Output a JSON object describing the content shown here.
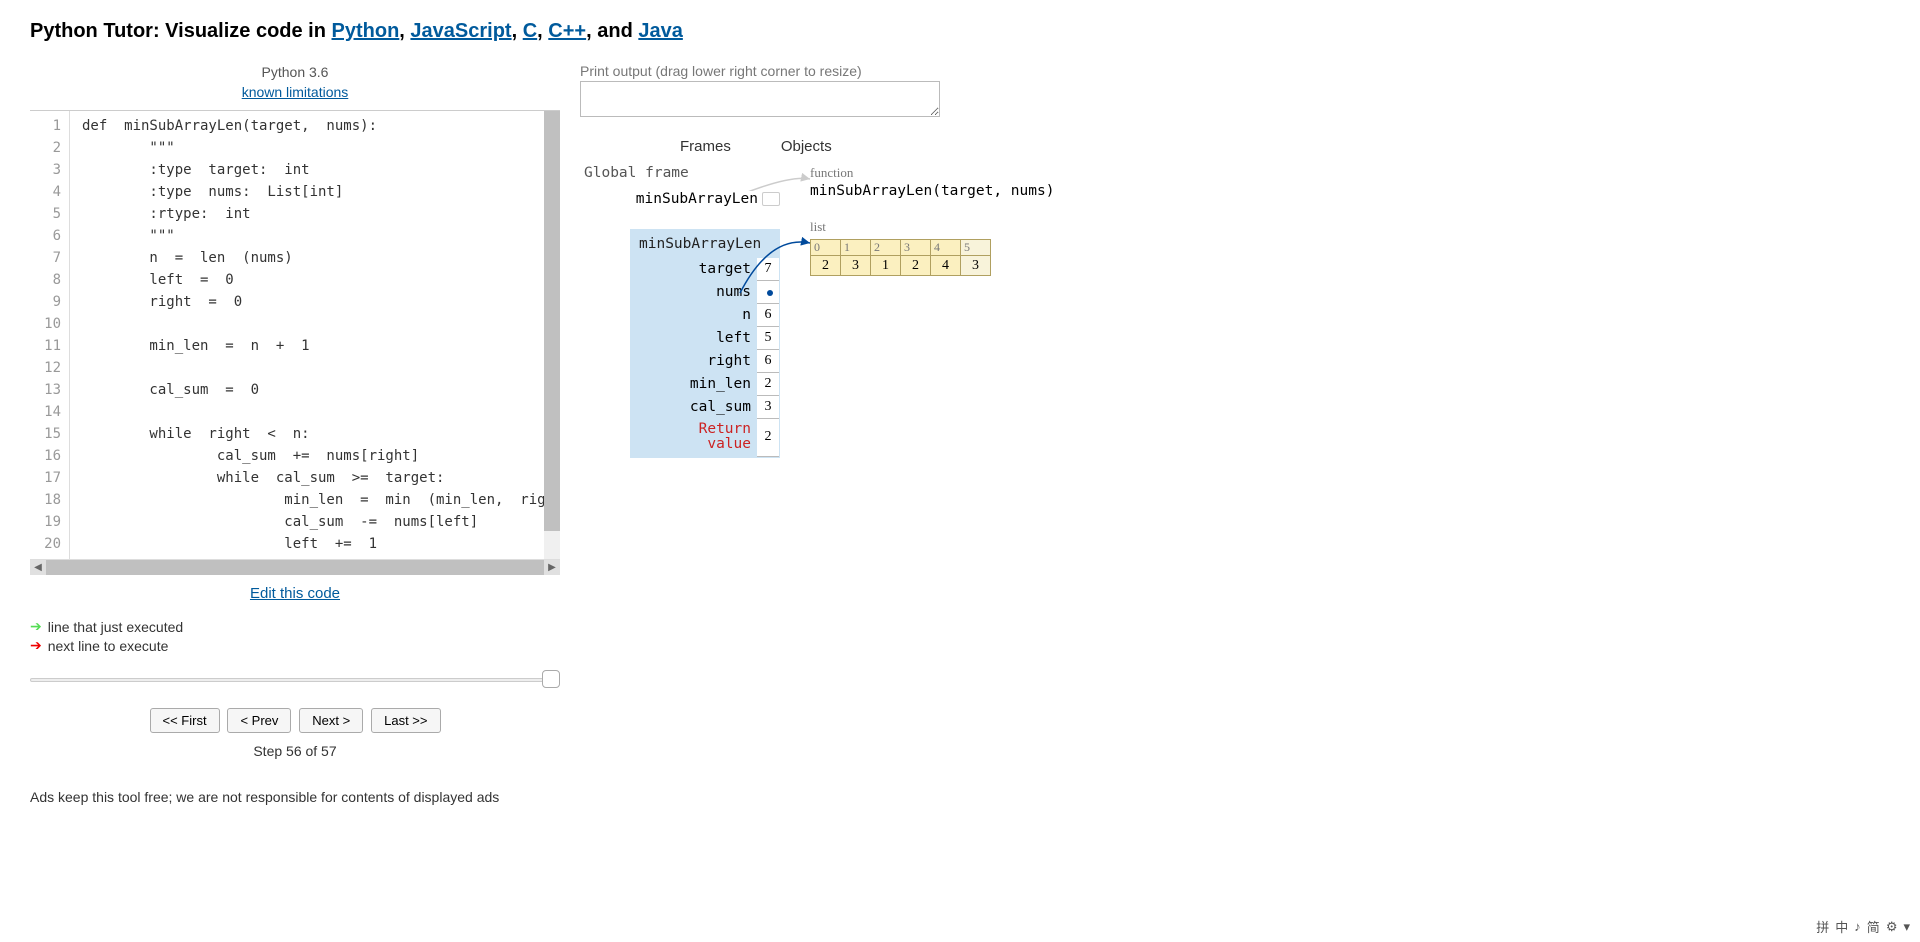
{
  "header": {
    "prefix": "Python Tutor: Visualize code in ",
    "links": [
      "Python",
      "JavaScript",
      "C",
      "C++",
      "Java"
    ],
    "seps": [
      ", ",
      ", ",
      ", ",
      ", and "
    ]
  },
  "code_header": {
    "lang": "Python 3.6",
    "limitations": "known limitations"
  },
  "code": [
    "def  minSubArrayLen(target,  nums):",
    "        \"\"\"",
    "        :type  target:  int",
    "        :type  nums:  List[int]",
    "        :rtype:  int",
    "        \"\"\"",
    "        n  =  len  (nums)",
    "        left  =  0",
    "        right  =  0",
    "",
    "        min_len  =  n  +  1",
    "",
    "        cal_sum  =  0",
    "",
    "        while  right  <  n:",
    "                cal_sum  +=  nums[right]",
    "                while  cal_sum  >=  target:",
    "                        min_len  =  min  (min_len,  right",
    "                        cal_sum  -=  nums[left]",
    "                        left  +=  1"
  ],
  "edit_link": "Edit this code",
  "legend": {
    "exec": "line that just executed",
    "next": "next line to execute"
  },
  "controls": {
    "first": "<< First",
    "prev": "< Prev",
    "next": "Next >",
    "last": "Last >>"
  },
  "step": "Step 56 of 57",
  "ads": "Ads keep this tool free; we are not responsible for contents of displayed ads",
  "output": {
    "label": "Print output (drag lower right corner to resize)"
  },
  "viz": {
    "frames_header": "Frames",
    "objects_header": "Objects",
    "global_label": "Global frame",
    "global_var": "minSubArrayLen",
    "frame": {
      "name": "minSubArrayLen",
      "vars": [
        {
          "k": "target",
          "v": "7"
        },
        {
          "k": "nums",
          "v": ""
        },
        {
          "k": "n",
          "v": "6"
        },
        {
          "k": "left",
          "v": "5"
        },
        {
          "k": "right",
          "v": "6"
        },
        {
          "k": "min_len",
          "v": "2"
        },
        {
          "k": "cal_sum",
          "v": "3"
        }
      ],
      "ret_label": "Return\nvalue",
      "ret_val": "2"
    },
    "func_label": "function",
    "func_sig": "minSubArrayLen(target,  nums)",
    "list_label": "list",
    "list_idx": [
      "0",
      "1",
      "2",
      "3",
      "4",
      "5"
    ],
    "list_val": [
      "2",
      "3",
      "1",
      "2",
      "4",
      "3"
    ]
  },
  "ime": [
    "拼",
    "中",
    "♪",
    "简",
    "⚙",
    "▾"
  ]
}
